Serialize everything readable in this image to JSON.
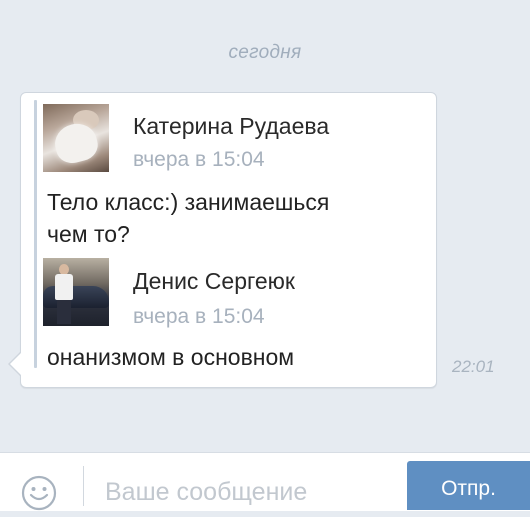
{
  "date_separator": "сегодня",
  "forwarded": [
    {
      "sender": "Катерина Рудаева",
      "time": "вчера в 15:04",
      "text_lines": [
        "Тело класс:) занимаешься",
        "чем то?"
      ]
    },
    {
      "sender": "Денис Сергеюк",
      "time": "вчера в 15:04",
      "text_lines": [
        "онанизмом в основном"
      ]
    }
  ],
  "message_time": "22:01",
  "composer": {
    "placeholder": "Ваше сообщение",
    "send_label": "Отпр."
  },
  "icons": {
    "emoji": "smiley-face-icon"
  },
  "colors": {
    "background": "#e6ebf1",
    "send_button": "#5f8fc2",
    "muted_text": "#a7b1bd"
  }
}
